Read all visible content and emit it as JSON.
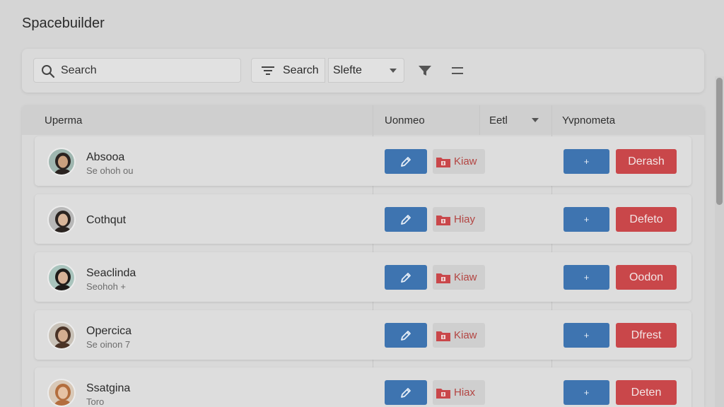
{
  "app": {
    "title": "Spacebuilder"
  },
  "toolbar": {
    "search_placeholder": "Search",
    "search_button": "Search",
    "select_value": "Slefte"
  },
  "table": {
    "columns": [
      "Uperma",
      "Uonmeo",
      "Eetl",
      "Yvpnometa"
    ],
    "rows": [
      {
        "name": "Absooa",
        "sub": "Se ohoh ou",
        "edit_label": "Kiaw",
        "action_label": "Derash",
        "plus_label": "+",
        "avatar_bg": "#9fb7b0",
        "avatar_hair": "#2a2320",
        "avatar_skin": "#c9a07e"
      },
      {
        "name": "Cothqut",
        "sub": "",
        "edit_label": "Hiay",
        "action_label": "Defeto",
        "plus_label": "+",
        "avatar_bg": "#b8b8b8",
        "avatar_hair": "#2a2320",
        "avatar_skin": "#d8b59a"
      },
      {
        "name": "Seaclinda",
        "sub": "Seohoh +",
        "edit_label": "Kiaw",
        "action_label": "Oodon",
        "plus_label": "+",
        "avatar_bg": "#a9c4bd",
        "avatar_hair": "#1e1a18",
        "avatar_skin": "#d7b196"
      },
      {
        "name": "Opercica",
        "sub": "Se oinon 7",
        "edit_label": "Kiaw",
        "action_label": "Dfrest",
        "plus_label": "+",
        "avatar_bg": "#c9c2b8",
        "avatar_hair": "#4a3326",
        "avatar_skin": "#d4ad90"
      },
      {
        "name": "Ssatgina",
        "sub": "Toro",
        "edit_label": "Hiax",
        "action_label": "Deten",
        "plus_label": "+",
        "avatar_bg": "#d9c9b8",
        "avatar_hair": "#b36e3e",
        "avatar_skin": "#e6c2a4"
      }
    ]
  },
  "colors": {
    "accent_blue": "#3e74b0",
    "danger_red": "#c9474a",
    "background": "#d5d5d5"
  },
  "icons": [
    "search-icon",
    "filter-lines-icon",
    "caret-down-icon",
    "funnel-icon",
    "menu-icon",
    "pencil-icon",
    "folder-icon",
    "plus-icon",
    "avatar"
  ]
}
